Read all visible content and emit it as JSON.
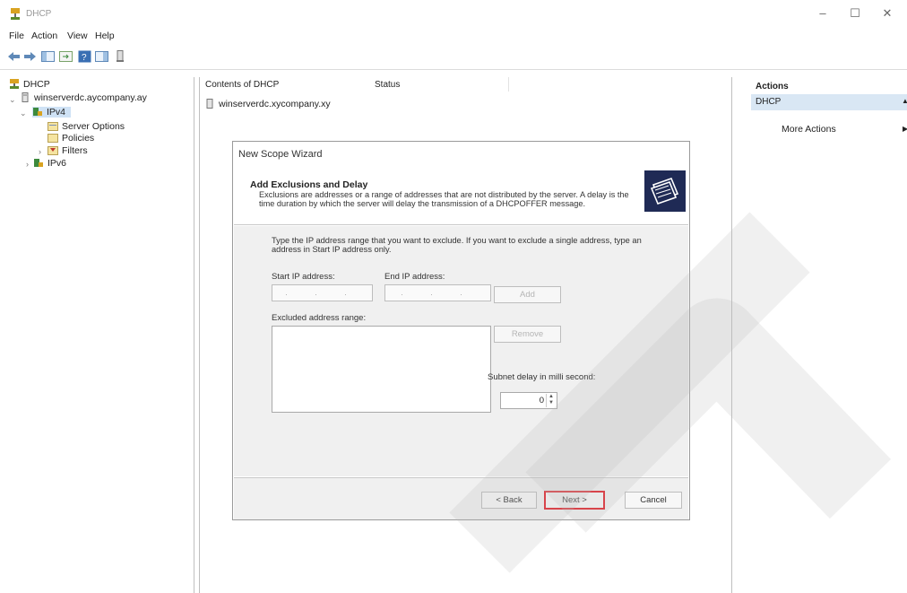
{
  "window": {
    "title": "DHCP",
    "minimize": "–",
    "maximize": "☐",
    "close": "✕"
  },
  "menu": [
    "File",
    "Action",
    "View",
    "Help"
  ],
  "tree": {
    "root": "DHCP",
    "server": "winserverdc.aycompany.ay",
    "ipv4": "IPv4",
    "server_options": "Server Options",
    "policies": "Policies",
    "filters": "Filters",
    "ipv6": "IPv6"
  },
  "content": {
    "col_contents": "Contents of DHCP",
    "col_status": "Status",
    "row_server": "winserverdc.xycompany.xy"
  },
  "actions": {
    "title": "Actions",
    "section": "DHCP",
    "section_arrow": "▲",
    "more": "More Actions",
    "more_arrow": "▶"
  },
  "wizard": {
    "title": "New Scope Wizard",
    "heading": "Add Exclusions and Delay",
    "description": "Exclusions are addresses or a range of addresses that are not distributed by the server. A delay is the time duration by which the server will delay the transmission of a DHCPOFFER message.",
    "instructions": "Type the IP address range that you want to exclude. If you want to exclude a single address, type an address in Start IP address only.",
    "start_ip_label": "Start IP address:",
    "end_ip_label": "End IP address:",
    "start_ip_value": "",
    "end_ip_value": "",
    "add_button": "Add",
    "excluded_label": "Excluded address range:",
    "remove_button": "Remove",
    "delay_label": "Subnet delay in milli second:",
    "delay_value": "0",
    "back_button": "< Back",
    "next_button": "Next >",
    "cancel_button": "Cancel"
  },
  "colors": {
    "highlight": "#d9e7f4",
    "next_border": "#e0232c",
    "logo_bg": "#1f2a55"
  }
}
